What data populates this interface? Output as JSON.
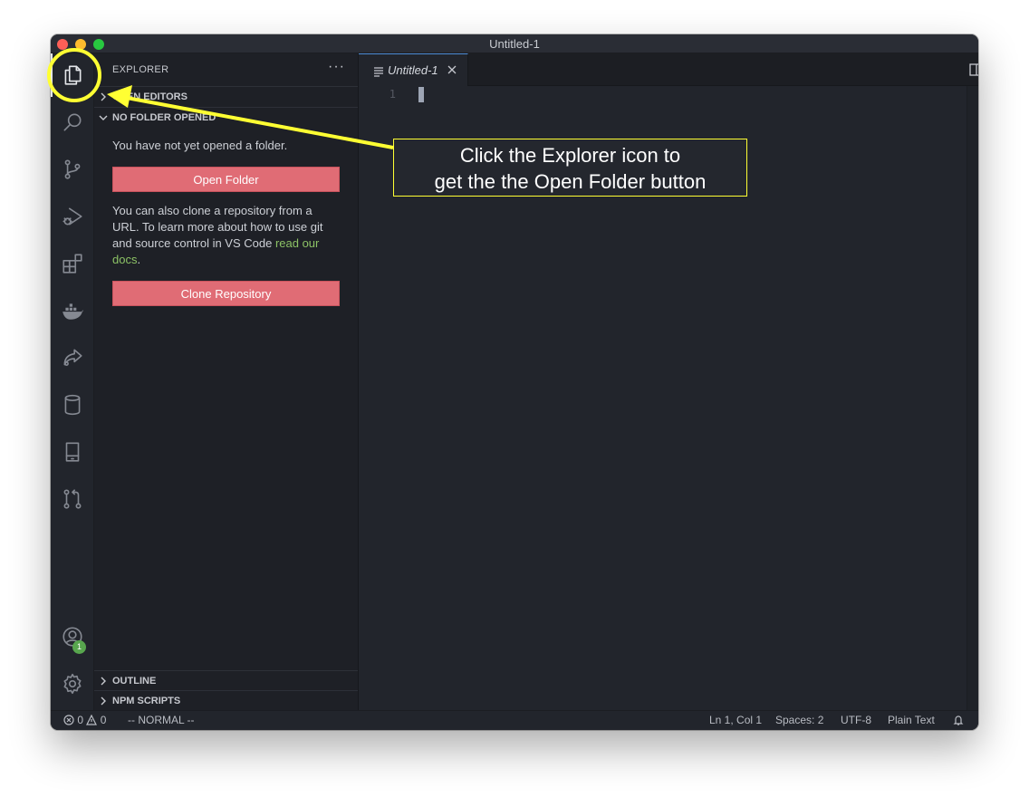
{
  "window": {
    "title": "Untitled-1"
  },
  "activity_bar": {
    "items": [
      "explorer-icon",
      "search-icon",
      "source-control-icon",
      "run-debug-icon",
      "extensions-icon",
      "docker-icon",
      "live-share-icon",
      "database-icon",
      "notebook-icon",
      "pull-request-icon"
    ],
    "accounts_badge": "1"
  },
  "sidebar": {
    "title": "EXPLORER",
    "more": "···",
    "open_editors": "OPEN EDITORS",
    "no_folder": "NO FOLDER OPENED",
    "message": "You have not yet opened a folder.",
    "open_folder_button": "Open Folder",
    "clone_text_before": "You can also clone a repository from a URL. To learn more about how to use git and source control in VS Code ",
    "clone_link": "read our docs",
    "clone_text_after": ".",
    "clone_button": "Clone Repository",
    "outline": "OUTLINE",
    "npm_scripts": "NPM SCRIPTS"
  },
  "editor": {
    "tab_name": "Untitled-1",
    "line_number": "1",
    "more": "···"
  },
  "statusbar": {
    "errors": "0",
    "warnings": "0",
    "mode": "-- NORMAL --",
    "position": "Ln 1, Col 1",
    "spaces": "Spaces: 2",
    "encoding": "UTF-8",
    "language": "Plain Text"
  },
  "annotation": {
    "line1": "Click the Explorer icon to",
    "line2": "get the the Open Folder button",
    "highlight_color": "#ffff33"
  },
  "colors": {
    "button": "#e06c75",
    "link": "#8cc265",
    "badge": "#58a64e",
    "tab_accent": "#4e8dd6"
  }
}
